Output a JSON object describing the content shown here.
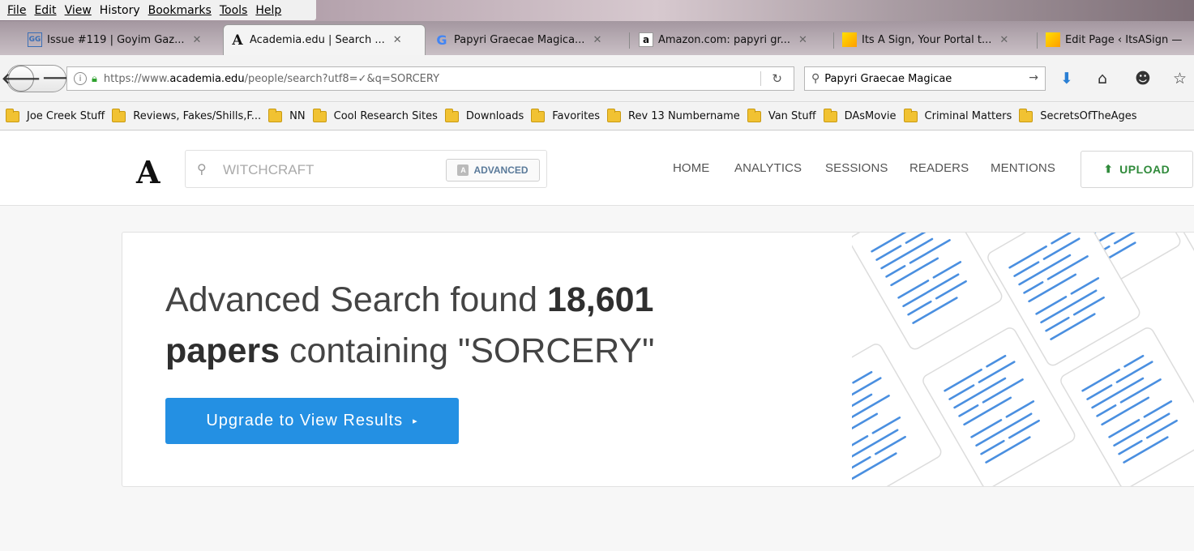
{
  "browser": {
    "menu": [
      "File",
      "Edit",
      "View",
      "History",
      "Bookmarks",
      "Tools",
      "Help"
    ],
    "tabs": [
      {
        "title": "Issue #119 | Goyim Gaz...",
        "favicon": "gg-icon"
      },
      {
        "title": "Academia.edu | Search ...",
        "favicon": "academia-icon",
        "active": true
      },
      {
        "title": "Papyri Graecae Magica...",
        "favicon": "google-icon"
      },
      {
        "title": "Amazon.com: papyri gr...",
        "favicon": "amazon-icon"
      },
      {
        "title": "Its A Sign, Your Portal t...",
        "favicon": "itsasign-icon"
      },
      {
        "title": "Edit Page ‹ ItsASign —",
        "favicon": "itsasign-icon"
      }
    ],
    "url_prefix": "https://www.",
    "url_domain": "academia.edu",
    "url_path": "/people/search?utf8=✓&q=SORCERY",
    "search_query": "Papyri Graecae Magicae",
    "bookmarks": [
      "Joe Creek Stuff",
      "Reviews, Fakes/Shills,F...",
      "NN",
      "Cool Research Sites",
      "Downloads",
      "Favorites",
      "Rev 13 Numbername",
      "Van Stuff",
      "DAsMovie",
      "Criminal Matters",
      "SecretsOfTheAges"
    ]
  },
  "site": {
    "logo": "A",
    "search_placeholder": "WITCHCRAFT",
    "advanced_label": "ADVANCED",
    "nav": [
      "HOME",
      "ANALYTICS",
      "SESSIONS",
      "READERS",
      "MENTIONS"
    ],
    "upload_label": "UPLOAD"
  },
  "result": {
    "prefix": "Advanced Search found ",
    "count": "18,601",
    "papers": "papers",
    "suffix": " containing \"SORCERY\"",
    "cta_label": "Upgrade to View Results"
  },
  "colors": {
    "accent": "#2490e3",
    "upload_green": "#2f8a3a",
    "lock_green": "#2fa22f",
    "folder_yellow": "#f1c232"
  }
}
